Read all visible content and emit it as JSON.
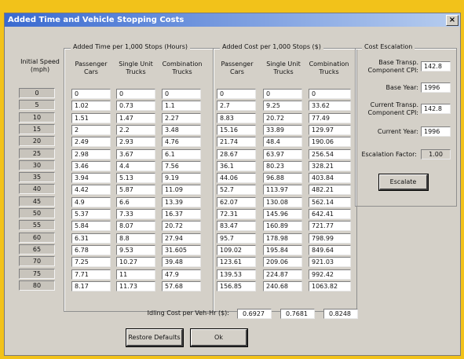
{
  "window": {
    "title": "Added Time and Vehicle Stopping Costs",
    "close": "×"
  },
  "speed_header": "Initial Speed\n(mph)",
  "speeds": [
    "0",
    "5",
    "10",
    "15",
    "20",
    "25",
    "30",
    "35",
    "40",
    "45",
    "50",
    "55",
    "60",
    "65",
    "70",
    "75",
    "80"
  ],
  "time_group": {
    "title": "Added Time per 1,000 Stops (Hours)",
    "headers": [
      "Passenger\nCars",
      "Single Unit\nTrucks",
      "Combination\nTrucks"
    ],
    "rows": [
      [
        "0",
        "0",
        "0"
      ],
      [
        "1.02",
        "0.73",
        "1.1"
      ],
      [
        "1.51",
        "1.47",
        "2.27"
      ],
      [
        "2",
        "2.2",
        "3.48"
      ],
      [
        "2.49",
        "2.93",
        "4.76"
      ],
      [
        "2.98",
        "3.67",
        "6.1"
      ],
      [
        "3.46",
        "4.4",
        "7.56"
      ],
      [
        "3.94",
        "5.13",
        "9.19"
      ],
      [
        "4.42",
        "5.87",
        "11.09"
      ],
      [
        "4.9",
        "6.6",
        "13.39"
      ],
      [
        "5.37",
        "7.33",
        "16.37"
      ],
      [
        "5.84",
        "8.07",
        "20.72"
      ],
      [
        "6.31",
        "8.8",
        "27.94"
      ],
      [
        "6.78",
        "9.53",
        "31.605"
      ],
      [
        "7.25",
        "10.27",
        "39.48"
      ],
      [
        "7.71",
        "11",
        "47.9"
      ],
      [
        "8.17",
        "11.73",
        "57.68"
      ]
    ]
  },
  "cost_group": {
    "title": "Added Cost per 1,000 Stops ($)",
    "headers": [
      "Passenger\nCars",
      "Single Unit\nTrucks",
      "Combination\nTrucks"
    ],
    "rows": [
      [
        "0",
        "0",
        "0"
      ],
      [
        "2.7",
        "9.25",
        "33.62"
      ],
      [
        "8.83",
        "20.72",
        "77.49"
      ],
      [
        "15.16",
        "33.89",
        "129.97"
      ],
      [
        "21.74",
        "48.4",
        "190.06"
      ],
      [
        "28.67",
        "63.97",
        "256.54"
      ],
      [
        "36.1",
        "80.23",
        "328.21"
      ],
      [
        "44.06",
        "96.88",
        "403.84"
      ],
      [
        "52.7",
        "113.97",
        "482.21"
      ],
      [
        "62.07",
        "130.08",
        "562.14"
      ],
      [
        "72.31",
        "145.96",
        "642.41"
      ],
      [
        "83.47",
        "160.89",
        "721.77"
      ],
      [
        "95.7",
        "178.98",
        "798.99"
      ],
      [
        "109.02",
        "195.84",
        "849.64"
      ],
      [
        "123.61",
        "209.06",
        "921.03"
      ],
      [
        "139.53",
        "224.87",
        "992.42"
      ],
      [
        "156.85",
        "240.68",
        "1063.82"
      ]
    ]
  },
  "idling": {
    "label": "Idling Cost per Veh-Hr ($):",
    "values": [
      "0.6927",
      "0.7681",
      "0.8248"
    ]
  },
  "escalation": {
    "title": "Cost Escalation",
    "base_cpi_label": "Base Transp.\nComponent CPI:",
    "base_cpi": "142.8",
    "base_year_label": "Base Year:",
    "base_year": "1996",
    "current_cpi_label": "Current Transp.\nComponent CPI:",
    "current_cpi": "142.8",
    "current_year_label": "Current Year:",
    "current_year": "1996",
    "factor_label": "Escalation Factor:",
    "factor": "1.00",
    "escalate_button": "Escalate"
  },
  "buttons": {
    "restore": "Restore Defaults",
    "ok": "Ok"
  }
}
